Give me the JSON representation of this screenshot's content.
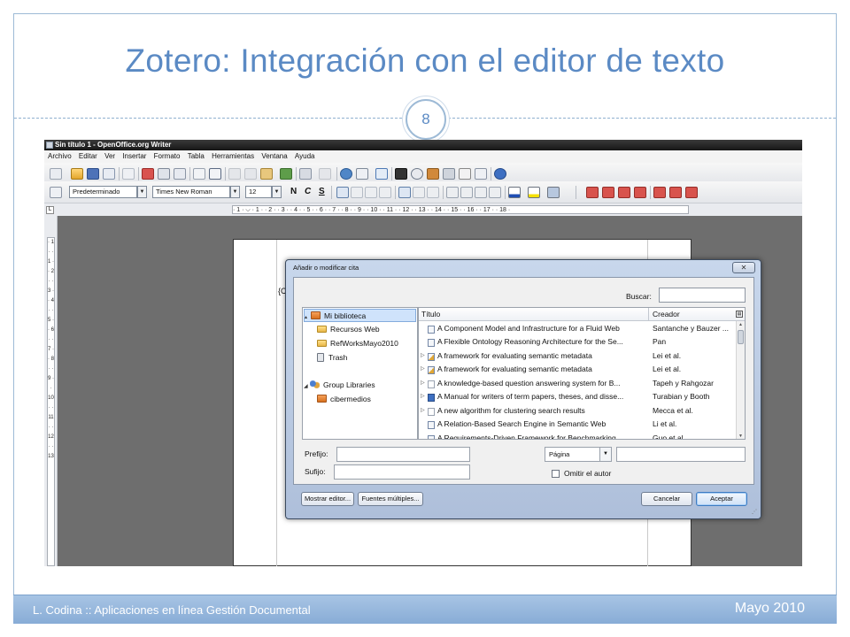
{
  "slide": {
    "title": "Zotero: Integración con el editor de texto",
    "page_number": "8",
    "footer_left": "L. Codina :: Aplicaciones en línea Gestión Documental",
    "footer_right": "Mayo 2010",
    "colors": {
      "accent": "#5b8ac4",
      "footer": "#94b6dc",
      "frame": "#9dbad6"
    }
  },
  "writer": {
    "window_title": "Sin título 1 - OpenOffice.org Writer",
    "menu": [
      "Archivo",
      "Editar",
      "Ver",
      "Insertar",
      "Formato",
      "Tabla",
      "Herramientas",
      "Ventana",
      "Ayuda"
    ],
    "paragraph_style": "Predeterminado",
    "font_name": "Times New Roman",
    "font_size": "12",
    "format_letters": {
      "bold": "N",
      "italic": "C",
      "underline": "S"
    },
    "ruler_text": "· 1 · ⌵ · 1 · · 2 · · 3 · · 4 · · 5 · · 6 · · 7 · · 8 · · 9 · · 10 · · 11 · · 12 · · 13 · · 14 · · 15 · · 16 · · 17 · · 18 ·",
    "vruler_text": "· 1 · · 1 · · 2 · · 3 · · 4 · · 5 · · 6 · · 7 · · 8 · · 9 · · 10 · · 11 · · 12 · · 13",
    "doc_text": "{C"
  },
  "dialog": {
    "title": "Añadir o modificar cita",
    "close_glyph": "✕",
    "search_label": "Buscar:",
    "search_value": "",
    "tree": [
      {
        "label": "Mi biblioteca",
        "icon": "library-icon",
        "twisty": "▴",
        "selected": true
      },
      {
        "label": "Recursos Web",
        "icon": "folder-icon"
      },
      {
        "label": "RefWorksMayo2010",
        "icon": "folder-icon"
      },
      {
        "label": "Trash",
        "icon": "trash-icon"
      },
      {
        "label": "Group Libraries",
        "icon": "group-icon",
        "twisty": "◢"
      },
      {
        "label": "cibermedios",
        "icon": "library-icon"
      }
    ],
    "columns": {
      "title": "Título",
      "creator": "Creador"
    },
    "items": [
      {
        "title": "A Component Model and Infrastructure for a Fluid Web",
        "creator": "Santanche y Bauzer ...",
        "icon": "journal-article-icon",
        "twisty": ""
      },
      {
        "title": "A Flexible Ontology Reasoning Architecture for the Se...",
        "creator": "Pan",
        "icon": "journal-article-icon",
        "twisty": ""
      },
      {
        "title": "A framework for evaluating semantic metadata",
        "creator": "Lei et al.",
        "icon": "attachment-item-icon",
        "twisty": "▷"
      },
      {
        "title": "A framework for evaluating semantic metadata",
        "creator": "Lei et al.",
        "icon": "attachment-item-icon",
        "twisty": "▷"
      },
      {
        "title": "A knowledge-based question answering system for B...",
        "creator": "Tapeh y Rahgozar",
        "icon": "document-icon",
        "twisty": "▷"
      },
      {
        "title": "A Manual for writers of term papers, theses, and disse...",
        "creator": "Turabian y Booth",
        "icon": "book-icon",
        "twisty": "▷"
      },
      {
        "title": "A new algorithm for clustering search results",
        "creator": "Mecca et al.",
        "icon": "document-icon",
        "twisty": "▷"
      },
      {
        "title": "A Relation-Based Search Engine in Semantic Web",
        "creator": "Li et al.",
        "icon": "journal-article-icon",
        "twisty": ""
      },
      {
        "title": "A Requirements-Driven Framework for Benchmarking",
        "creator": "Guo et al.",
        "icon": "journal-article-icon",
        "twisty": ""
      }
    ],
    "prefix_label": "Prefijo:",
    "prefix_value": "",
    "suffix_label": "Sufijo:",
    "suffix_value": "",
    "locator_select": "Página",
    "locator_value": "",
    "omit_author_label": "Omitir el autor",
    "omit_author_checked": false,
    "buttons": {
      "show_editor": "Mostrar editor...",
      "multiple_sources": "Fuentes múltiples...",
      "cancel": "Cancelar",
      "accept": "Aceptar"
    }
  }
}
